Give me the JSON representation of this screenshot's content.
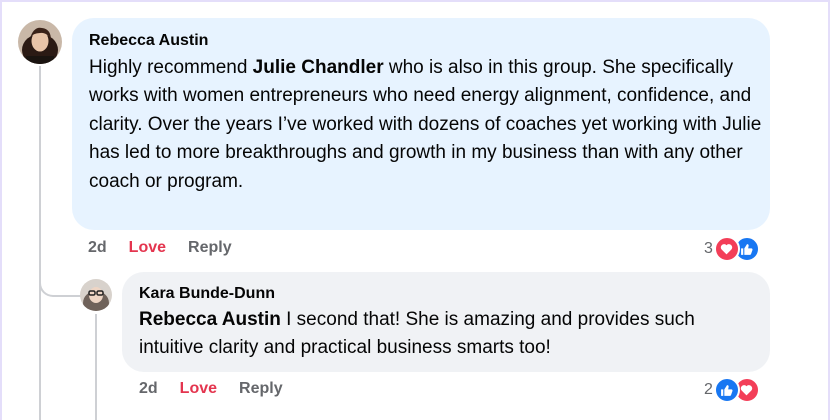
{
  "comment": {
    "author": "Rebecca Austin",
    "text_before": "Highly recommend ",
    "mention": "Julie Chandler",
    "text_after": " who is also in this group. She specifically works with women entrepreneurs who need energy alignment, confidence, and clarity. Over the years I’ve worked with dozens of coaches yet working with Julie has led to more breakthroughs and growth in my business than with any other coach or program.",
    "time": "2d",
    "love_label": "Love",
    "reply_label": "Reply",
    "reaction_count": "3",
    "reaction_icons": [
      "heart-icon",
      "like-icon"
    ]
  },
  "reply": {
    "author": "Kara Bunde-Dunn",
    "mention": "Rebecca Austin",
    "text_after": " I second that! She is amazing and provides such intuitive clarity and practical business smarts too!",
    "time": "2d",
    "love_label": "Love",
    "reply_label": "Reply",
    "reaction_count": "2",
    "reaction_icons": [
      "like-icon",
      "heart-icon"
    ]
  },
  "colors": {
    "bubble_main": "#e7f3ff",
    "bubble_reply": "#f0f2f5",
    "love": "#e4354f",
    "heart": "#f33e58",
    "like": "#1877f2",
    "muted": "#65676b"
  }
}
